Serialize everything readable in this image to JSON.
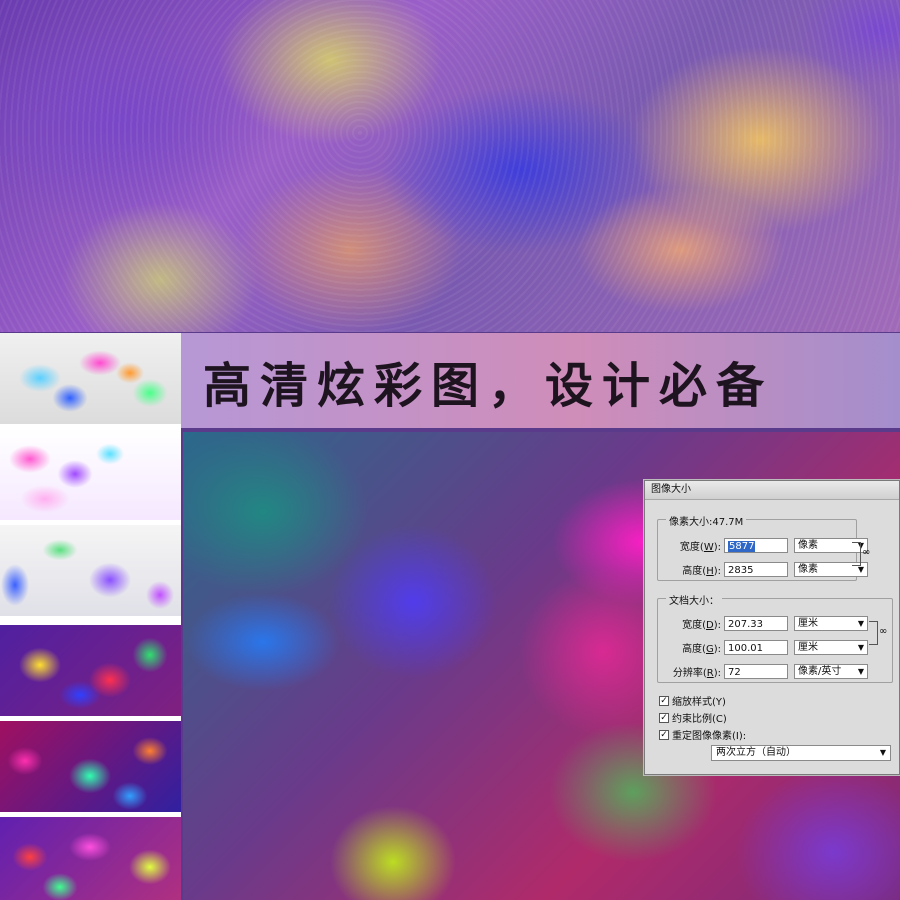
{
  "banner": {
    "text": "高清炫彩图，设计必备"
  },
  "dialog": {
    "title": "图像大小",
    "pixel_group": {
      "legend": "像素大小:47.7M",
      "width": {
        "label": "宽度(",
        "key": "W",
        "suffix": "):",
        "value": "5877",
        "unit": "像素"
      },
      "height": {
        "label": "高度(",
        "key": "H",
        "suffix": "):",
        "value": "2835",
        "unit": "像素"
      }
    },
    "doc_group": {
      "legend": "文档大小：",
      "width": {
        "label": "宽度(",
        "key": "D",
        "suffix": "):",
        "value": "207.33",
        "unit": "厘米"
      },
      "height": {
        "label": "高度(",
        "key": "G",
        "suffix": "):",
        "value": "100.01",
        "unit": "厘米"
      },
      "resolution": {
        "label": "分辨率(",
        "key": "R",
        "suffix": "):",
        "value": "72",
        "unit": "像素/英寸"
      }
    },
    "options": {
      "scale_styles": {
        "label": "缩放样式(Y)",
        "checked": true
      },
      "constrain": {
        "label": "约束比例(C)",
        "checked": true
      },
      "resample": {
        "label": "重定图像像素(I):",
        "checked": true
      }
    },
    "resample_method": "两次立方（自动）"
  }
}
